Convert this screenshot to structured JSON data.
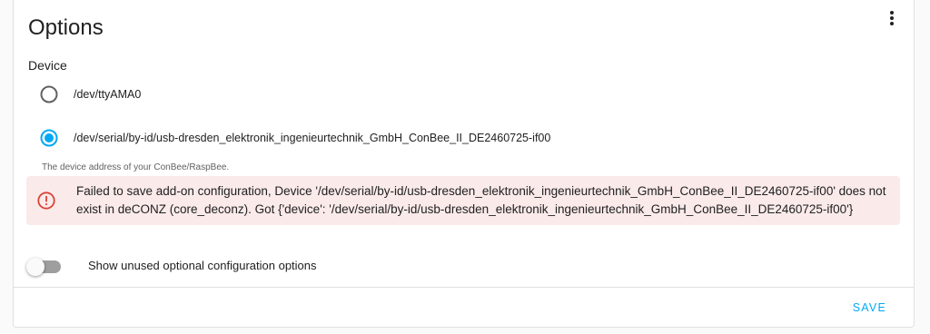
{
  "card": {
    "title": "Options",
    "menu_icon": "dots-vertical-icon"
  },
  "device": {
    "label": "Device",
    "options": [
      {
        "label": "/dev/ttyAMA0",
        "selected": false
      },
      {
        "label": "/dev/serial/by-id/usb-dresden_elektronik_ingenieurtechnik_GmbH_ConBee_II_DE2460725-if00",
        "selected": true
      }
    ],
    "helper": "The device address of your ConBee/RaspBee."
  },
  "error": {
    "icon": "alert-circle-icon",
    "line1": "Failed to save add-on configuration, Device '/dev/serial/by-id/usb-dresden_elektronik_ingenieurtechnik_GmbH_ConBee_II_DE2460725-if00' does not",
    "line2": "exist in deCONZ (core_deconz). Got {'device': '/dev/serial/by-id/usb-dresden_elektronik_ingenieurtechnik_GmbH_ConBee_II_DE2460725-if00'}"
  },
  "toggle": {
    "label": "Show unused optional configuration options",
    "on": false
  },
  "actions": {
    "save": "SAVE"
  },
  "colors": {
    "accent": "#03a9f4",
    "error_icon": "#db4437",
    "error_bg": "#fbeaea"
  }
}
